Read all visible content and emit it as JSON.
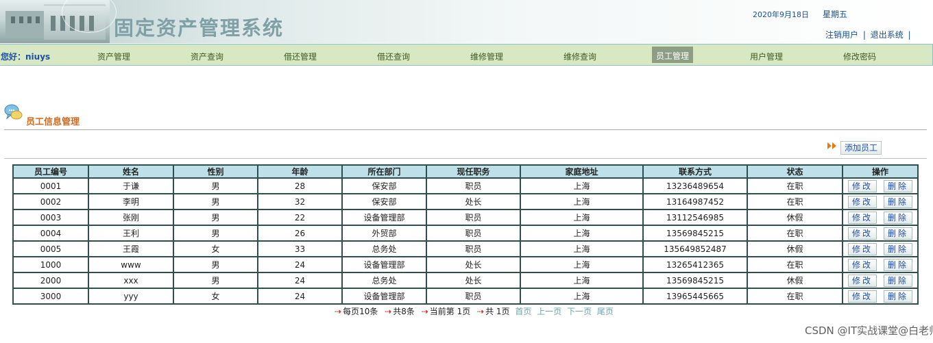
{
  "header": {
    "title": "固定资产管理系统",
    "date": "2020年9月18日",
    "weekday": "星期五",
    "logout_user": "注销用户",
    "exit_system": "退出系统",
    "separator": "|"
  },
  "nav": {
    "greeting": "您好：niuys",
    "items": [
      {
        "label": "资产管理"
      },
      {
        "label": "资产查询"
      },
      {
        "label": "借还管理"
      },
      {
        "label": "借还查询"
      },
      {
        "label": "维修管理"
      },
      {
        "label": "维修查询"
      },
      {
        "label": "员工管理",
        "active": true
      },
      {
        "label": "用户管理"
      },
      {
        "label": "修改密码"
      }
    ]
  },
  "section": {
    "title": "员工信息管理",
    "add_button": "添加员工"
  },
  "table": {
    "headers": [
      "员工编号",
      "姓名",
      "性别",
      "年龄",
      "所在部门",
      "现任职务",
      "家庭地址",
      "联系方式",
      "状态",
      "操作"
    ],
    "edit_label": "修改",
    "delete_label": "删除",
    "rows": [
      [
        "0001",
        "于谦",
        "男",
        "28",
        "保安部",
        "职员",
        "上海",
        "13236489654",
        "在职"
      ],
      [
        "0002",
        "李明",
        "男",
        "32",
        "保安部",
        "处长",
        "上海",
        "13164987452",
        "在职"
      ],
      [
        "0003",
        "张刚",
        "男",
        "22",
        "设备管理部",
        "职员",
        "上海",
        "13112546985",
        "休假"
      ],
      [
        "0004",
        "王利",
        "男",
        "26",
        "外贸部",
        "职员",
        "上海",
        "13569845215",
        "在职"
      ],
      [
        "0005",
        "王霞",
        "女",
        "33",
        "总务处",
        "职员",
        "上海",
        "135649852487",
        "休假"
      ],
      [
        "1000",
        "www",
        "男",
        "24",
        "设备管理部",
        "处长",
        "上海",
        "13265412365",
        "在职"
      ],
      [
        "2000",
        "xxx",
        "男",
        "24",
        "总务处",
        "处长",
        "上海",
        "13569845215",
        "休假"
      ],
      [
        "3000",
        "yyy",
        "女",
        "24",
        "设备管理部",
        "职员",
        "上海",
        "13965445665",
        "在职"
      ]
    ]
  },
  "pager": {
    "per_page": "每页10条",
    "total": "共8条",
    "current": "当前第 1页",
    "pages": "共 1页",
    "first": "首页",
    "prev": "上一页",
    "next": "下一页",
    "last": "尾页"
  },
  "watermark": "CSDN @IT实战课堂@白老师"
}
